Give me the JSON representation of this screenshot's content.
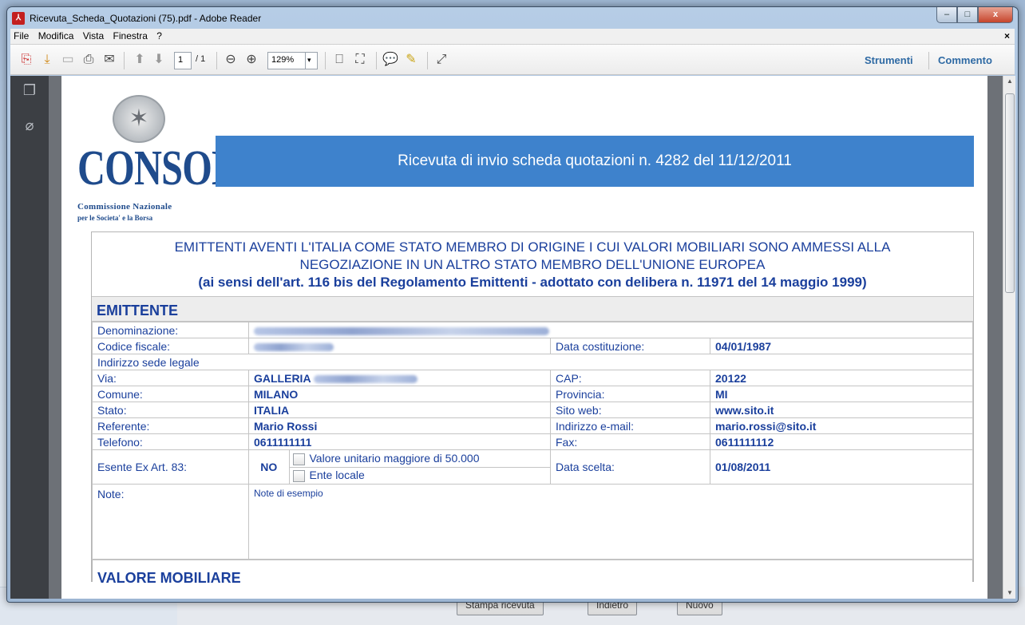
{
  "background_page": {
    "buttons": [
      "Stampa ricevuta",
      "Indietro",
      "Nuovo"
    ]
  },
  "window": {
    "title": "Ricevuta_Scheda_Quotazioni (75).pdf - Adobe Reader",
    "controls": {
      "minimize": "–",
      "maximize": "□",
      "close": "x"
    }
  },
  "menu": {
    "items": [
      "File",
      "Modifica",
      "Vista",
      "Finestra",
      "?"
    ],
    "close": "×"
  },
  "toolbar": {
    "page_current": "1",
    "page_total": "/ 1",
    "zoom": "129%",
    "tools_label": "Strumenti",
    "comment_label": "Commento"
  },
  "document": {
    "logo": {
      "name": "CONSOB",
      "sub1": "Commissione Nazionale",
      "sub2": "per le Societa' e la Borsa"
    },
    "banner": "Ricevuta di invio scheda quotazioni n. 4282 del 11/12/2011",
    "heading": {
      "line1": "EMITTENTI AVENTI L'ITALIA COME STATO MEMBRO DI ORIGINE I CUI VALORI MOBILIARI SONO AMMESSI ALLA",
      "line2": "NEGOZIAZIONE IN UN ALTRO STATO MEMBRO DELL'UNIONE EUROPEA",
      "line3": "(ai sensi dell'art. 116 bis del Regolamento Emittenti - adottato con delibera n. 11971 del 14 maggio 1999)"
    },
    "section_emittente": "EMITTENTE",
    "fields": {
      "denominazione_label": "Denominazione:",
      "codice_fiscale_label": "Codice fiscale:",
      "data_costituzione_label": "Data costituzione:",
      "data_costituzione": "04/01/1987",
      "indirizzo_label": "Indirizzo sede legale",
      "via_label": "Via:",
      "via_value": "GALLERIA",
      "cap_label": "CAP:",
      "cap": "20122",
      "comune_label": "Comune:",
      "comune": "MILANO",
      "provincia_label": "Provincia:",
      "provincia": "MI",
      "stato_label": "Stato:",
      "stato": "ITALIA",
      "sito_label": "Sito web:",
      "sito": "www.sito.it",
      "referente_label": "Referente:",
      "referente": "Mario Rossi",
      "email_label": "Indirizzo e-mail:",
      "email": "mario.rossi@sito.it",
      "telefono_label": "Telefono:",
      "telefono": "0611111111",
      "fax_label": "Fax:",
      "fax": "0611111112",
      "esente_label": "Esente Ex Art. 83:",
      "esente": "NO",
      "check1_label": "Valore unitario maggiore di 50.000",
      "check2_label": "Ente locale",
      "data_scelta_label": "Data scelta:",
      "data_scelta": "01/08/2011",
      "note_label": "Note:",
      "note": "Note di esempio"
    },
    "section_valore": "VALORE MOBILIARE"
  }
}
